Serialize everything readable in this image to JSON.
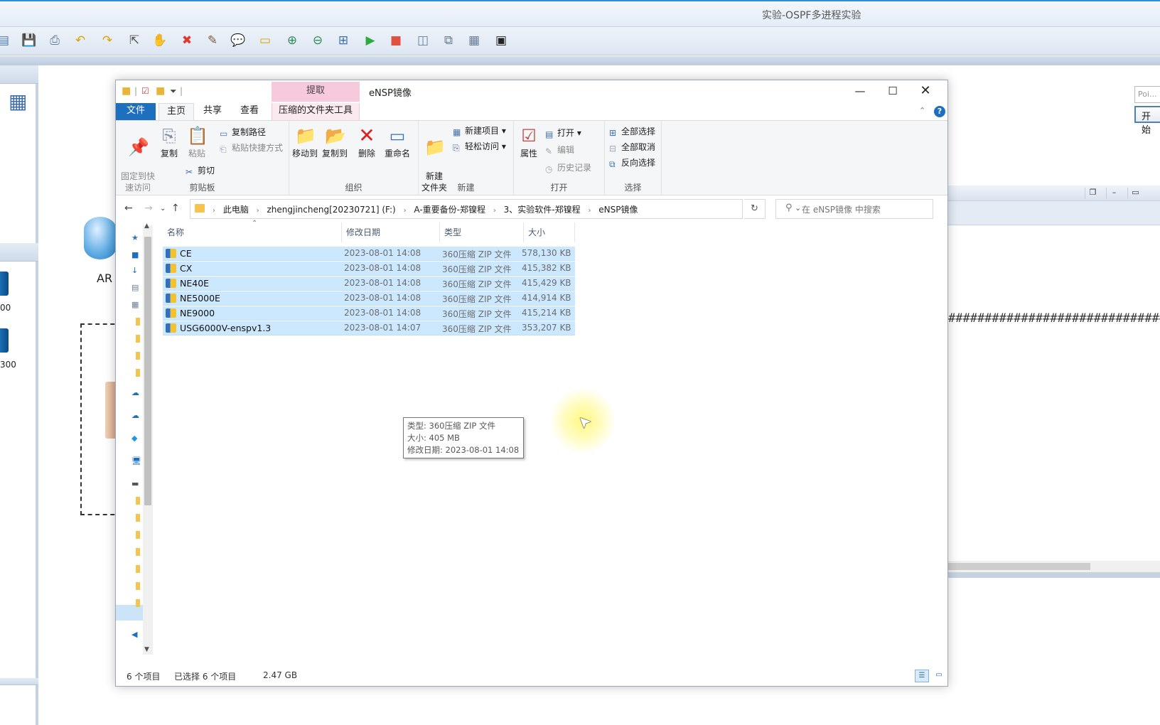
{
  "app": {
    "title": "实验-OSPF多进程实验",
    "device_label": "AR",
    "left_labels": [
      "00",
      "300"
    ],
    "right_input_placeholder": "Poi...",
    "right_button_label": "开始",
    "cli_text": "##############################"
  },
  "explorer": {
    "context_tab": "提取",
    "title": "eNSP镜像",
    "tabs": {
      "file": "文件",
      "home": "主页",
      "share": "共享",
      "view": "查看",
      "zip_tools": "压缩的文件夹工具"
    },
    "ribbon": {
      "clipboard": {
        "label": "剪贴板",
        "pin": "固定到快\n速访问",
        "copy": "复制",
        "paste": "粘贴",
        "copy_path": "复制路径",
        "paste_shortcut": "粘贴快捷方式",
        "cut": "剪切"
      },
      "organize": {
        "label": "组织",
        "move_to": "移动到",
        "copy_to": "复制到",
        "delete": "删除",
        "rename": "重命名"
      },
      "new": {
        "label": "新建",
        "new_folder": "新建\n文件夹",
        "new_item": "新建项目",
        "easy_access": "轻松访问"
      },
      "open": {
        "label": "打开",
        "properties": "属性",
        "open": "打开",
        "edit": "编辑",
        "history": "历史记录"
      },
      "select": {
        "label": "选择",
        "select_all": "全部选择",
        "select_none": "全部取消",
        "invert": "反向选择"
      }
    },
    "breadcrumbs": [
      "此电脑",
      "zhengjincheng[20230721] (F:)",
      "A-重要备份-郑镍程",
      "3、实验软件-郑镍程",
      "eNSP镜像"
    ],
    "search_placeholder": "在 eNSP镜像 中搜索",
    "columns": {
      "name": "名称",
      "date": "修改日期",
      "type": "类型",
      "size": "大小"
    },
    "files": [
      {
        "name": "CE",
        "date": "2023-08-01 14:08",
        "type": "360压缩 ZIP 文件",
        "size": "578,130 KB"
      },
      {
        "name": "CX",
        "date": "2023-08-01 14:08",
        "type": "360压缩 ZIP 文件",
        "size": "415,382 KB"
      },
      {
        "name": "NE40E",
        "date": "2023-08-01 14:08",
        "type": "360压缩 ZIP 文件",
        "size": "415,429 KB"
      },
      {
        "name": "NE5000E",
        "date": "2023-08-01 14:08",
        "type": "360压缩 ZIP 文件",
        "size": "414,914 KB"
      },
      {
        "name": "NE9000",
        "date": "2023-08-01 14:08",
        "type": "360压缩 ZIP 文件",
        "size": "415,214 KB"
      },
      {
        "name": "USG6000V-enspv1.3",
        "date": "2023-08-01 14:07",
        "type": "360压缩 ZIP 文件",
        "size": "353,207 KB"
      }
    ],
    "tooltip": {
      "type": "类型: 360压缩 ZIP 文件",
      "size": "大小: 405 MB",
      "date": "修改日期: 2023-08-01 14:08"
    },
    "status": {
      "count": "6 个项目",
      "selected": "已选择 6 个项目",
      "size": "2.47 GB"
    }
  }
}
